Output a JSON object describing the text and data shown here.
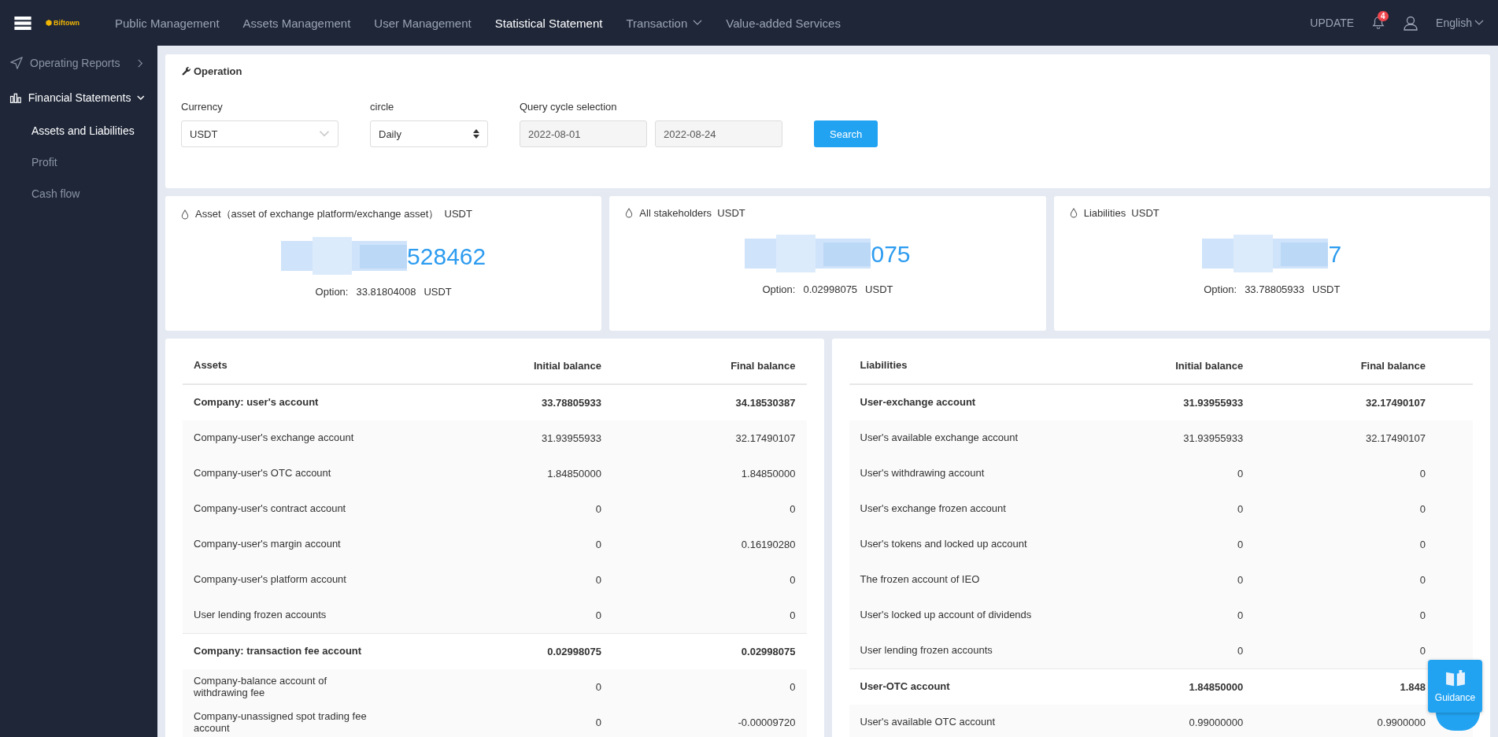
{
  "header": {
    "logo_text": "Biftown",
    "nav": [
      {
        "label": "Public Management",
        "selected": false,
        "dropdown": false
      },
      {
        "label": "Assets Management",
        "selected": false,
        "dropdown": false
      },
      {
        "label": "User Management",
        "selected": false,
        "dropdown": false
      },
      {
        "label": "Statistical Statement",
        "selected": true,
        "dropdown": false
      },
      {
        "label": "Transaction",
        "selected": false,
        "dropdown": true
      },
      {
        "label": "Value-added Services",
        "selected": false,
        "dropdown": false
      }
    ],
    "update": "UPDATE",
    "notification_count": "4",
    "language": "English"
  },
  "sidebar": {
    "items": [
      {
        "label": "Operating Reports",
        "kind": "send",
        "expanded": false
      },
      {
        "label": "Financial Statements",
        "kind": "chart",
        "expanded": true,
        "children": [
          {
            "label": "Assets and Liabilities",
            "selected": true
          },
          {
            "label": "Profit",
            "selected": false
          },
          {
            "label": "Cash flow",
            "selected": false
          }
        ]
      }
    ]
  },
  "operation": {
    "title": "Operation",
    "currency": {
      "label": "Currency",
      "value": "USDT"
    },
    "circle": {
      "label": "circle",
      "value": "Daily"
    },
    "query": {
      "label": "Query cycle selection",
      "start": "2022-08-01",
      "end": "2022-08-24"
    },
    "search_button": "Search"
  },
  "summary_cards": [
    {
      "title": "Asset（asset of exchange platform/exchange asset）  USDT",
      "amount": "528462",
      "option_label": "Option:",
      "option_value": "33.81804008",
      "option_unit": "USDT"
    },
    {
      "title": "All stakeholders  USDT",
      "amount": "075",
      "option_label": "Option:",
      "option_value": "0.02998075",
      "option_unit": "USDT"
    },
    {
      "title": "Liabilities  USDT",
      "amount": "7",
      "option_label": "Option:",
      "option_value": "33.78805933",
      "option_unit": "USDT"
    }
  ],
  "tables": [
    {
      "columns": [
        "Assets",
        "Initial balance",
        "Final balance"
      ],
      "rows": [
        {
          "kind": "group",
          "name": "Company: user's account",
          "initial": "33.78805933",
          "final": "34.18530387"
        },
        {
          "kind": "item",
          "name": "Company-user's exchange account",
          "initial": "31.93955933",
          "final": "32.17490107"
        },
        {
          "kind": "item",
          "name": "Company-user's OTC account",
          "initial": "1.84850000",
          "final": "1.84850000"
        },
        {
          "kind": "item",
          "name": "Company-user's contract account",
          "initial": "0",
          "final": "0"
        },
        {
          "kind": "item",
          "name": "Company-user's margin account",
          "initial": "0",
          "final": "0.16190280"
        },
        {
          "kind": "item",
          "name": "Company-user's platform account",
          "initial": "0",
          "final": "0"
        },
        {
          "kind": "item",
          "name": "User lending frozen accounts",
          "initial": "0",
          "final": "0"
        },
        {
          "kind": "group",
          "name": "Company: transaction fee account",
          "initial": "0.02998075",
          "final": "0.02998075"
        },
        {
          "kind": "item",
          "name": "Company-balance account of withdrawing fee",
          "initial": "0",
          "final": "0"
        },
        {
          "kind": "item",
          "name": "Company-unassigned spot trading fee account",
          "initial": "0",
          "final": "-0.00009720"
        }
      ]
    },
    {
      "columns": [
        "Liabilities",
        "Initial balance",
        "Final balance"
      ],
      "rows": [
        {
          "kind": "group",
          "name": "User-exchange account",
          "initial": "31.93955933",
          "final": "32.17490107"
        },
        {
          "kind": "item",
          "name": "User's available exchange account",
          "initial": "31.93955933",
          "final": "32.17490107"
        },
        {
          "kind": "item",
          "name": "User's withdrawing account",
          "initial": "0",
          "final": "0"
        },
        {
          "kind": "item",
          "name": "User's exchange frozen account",
          "initial": "0",
          "final": "0"
        },
        {
          "kind": "item",
          "name": "User's tokens and locked up account",
          "initial": "0",
          "final": "0"
        },
        {
          "kind": "item",
          "name": "The frozen account of IEO",
          "initial": "0",
          "final": "0"
        },
        {
          "kind": "item",
          "name": "User's locked up account of dividends",
          "initial": "0",
          "final": "0"
        },
        {
          "kind": "item",
          "name": "User lending frozen accounts",
          "initial": "0",
          "final": "0"
        },
        {
          "kind": "group",
          "name": "User-OTC account",
          "initial": "1.84850000",
          "final": "1.848"
        },
        {
          "kind": "item",
          "name": "User's available OTC account",
          "initial": "0.99000000",
          "final": "0.9900000"
        }
      ]
    }
  ],
  "guidance_button": "Guidance"
}
